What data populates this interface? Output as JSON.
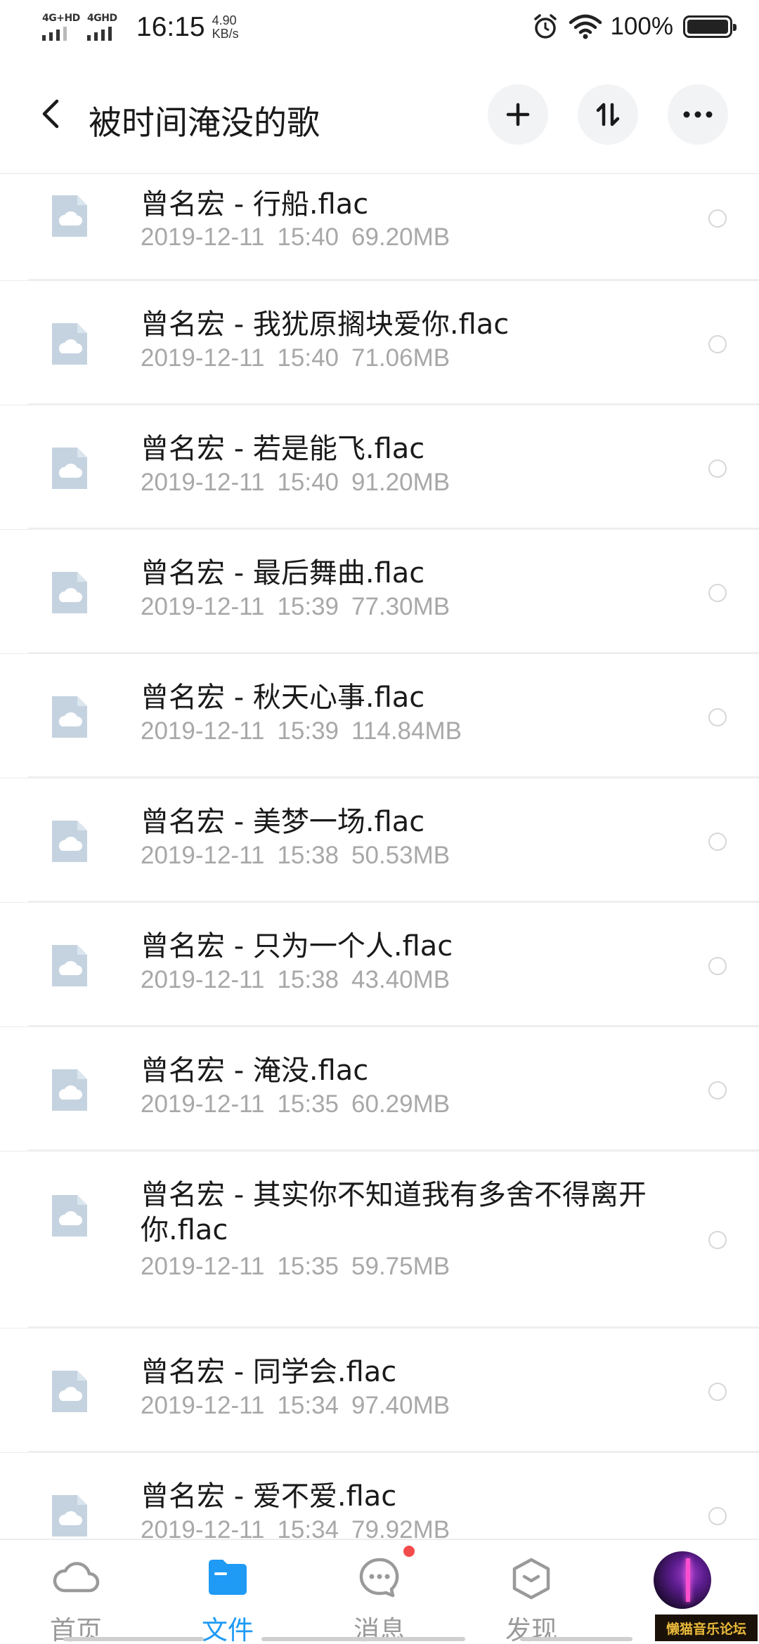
{
  "status_bar": {
    "signal1_label": "4G+HD",
    "signal2_label": "4GHD",
    "time": "16:15",
    "speed_value": "4.90",
    "speed_unit": "KB/s",
    "battery_pct": "100%"
  },
  "header": {
    "title": "被时间淹没的歌",
    "back_icon": "chevron-left-icon",
    "add_icon": "plus-icon",
    "sort_icon": "sort-icon",
    "more_icon": "more-icon"
  },
  "files": [
    {
      "name": "曾名宏 - 行船.flac",
      "date": "2019-12-11",
      "time": "15:40",
      "size": "69.20MB"
    },
    {
      "name": "曾名宏 - 我犹原搁块爱你.flac",
      "date": "2019-12-11",
      "time": "15:40",
      "size": "71.06MB"
    },
    {
      "name": "曾名宏 - 若是能飞.flac",
      "date": "2019-12-11",
      "time": "15:40",
      "size": "91.20MB"
    },
    {
      "name": "曾名宏 - 最后舞曲.flac",
      "date": "2019-12-11",
      "time": "15:39",
      "size": "77.30MB"
    },
    {
      "name": "曾名宏 - 秋天心事.flac",
      "date": "2019-12-11",
      "time": "15:39",
      "size": "114.84MB"
    },
    {
      "name": "曾名宏 - 美梦一场.flac",
      "date": "2019-12-11",
      "time": "15:38",
      "size": "50.53MB"
    },
    {
      "name": "曾名宏 - 只为一个人.flac",
      "date": "2019-12-11",
      "time": "15:38",
      "size": "43.40MB"
    },
    {
      "name": "曾名宏 - 淹没.flac",
      "date": "2019-12-11",
      "time": "15:35",
      "size": "60.29MB"
    },
    {
      "name": "曾名宏 - 其实你不知道我有多舍不得离开你.flac",
      "date": "2019-12-11",
      "time": "15:35",
      "size": "59.75MB"
    },
    {
      "name": "曾名宏 - 同学会.flac",
      "date": "2019-12-11",
      "time": "15:34",
      "size": "97.40MB"
    },
    {
      "name": "曾名宏 - 爱不爱.flac",
      "date": "2019-12-11",
      "time": "15:34",
      "size": "79.92MB"
    }
  ],
  "bottom_nav": {
    "tabs": [
      {
        "label": "首页",
        "icon": "cloud-icon",
        "active": false
      },
      {
        "label": "文件",
        "icon": "folder-icon",
        "active": true
      },
      {
        "label": "消息",
        "icon": "chat-icon",
        "active": false
      },
      {
        "label": "发现",
        "icon": "discover-icon",
        "active": false
      }
    ],
    "active_color": "#1f9af5"
  },
  "watermark": "懒猫音乐论坛"
}
